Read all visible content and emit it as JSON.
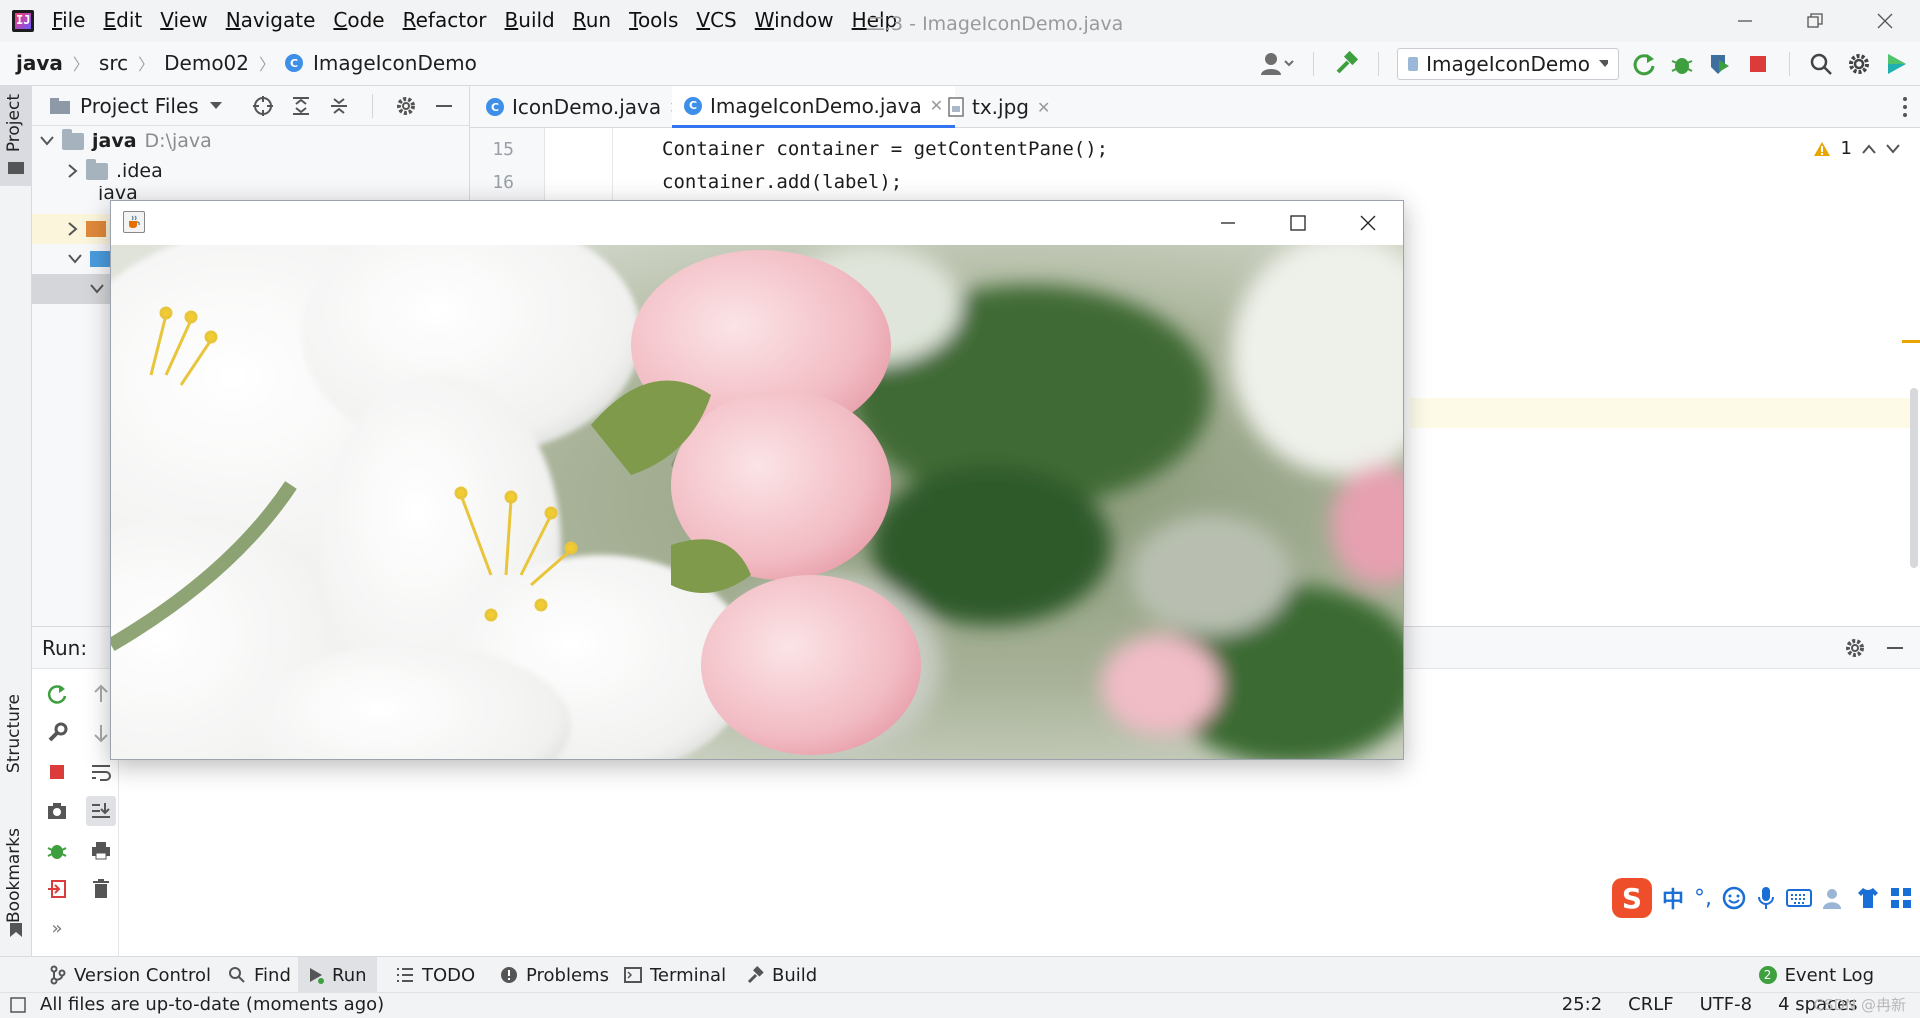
{
  "menubar": {
    "items": [
      "File",
      "Edit",
      "View",
      "Navigate",
      "Code",
      "Refactor",
      "Build",
      "Run",
      "Tools",
      "VCS",
      "Window",
      "Help"
    ],
    "title": "二.3 - ImageIconDemo.java"
  },
  "navbar": {
    "crumbs": [
      "java",
      "src",
      "Demo02",
      "ImageIconDemo"
    ],
    "run_config": "ImageIconDemo"
  },
  "left_strip": {
    "project": "Project",
    "structure": "Structure",
    "bookmarks": "Bookmarks"
  },
  "project_panel": {
    "header": "Project Files",
    "root_name": "java",
    "root_path": "D:\\java",
    "idea": ".idea",
    "partial": "java"
  },
  "editor": {
    "tabs": [
      {
        "label": "IconDemo.java"
      },
      {
        "label": "ImageIconDemo.java"
      },
      {
        "label": "tx.jpg"
      }
    ],
    "lines": [
      {
        "num": "15",
        "code": "Container container = getContentPane();"
      },
      {
        "num": "16",
        "code": "container.add(label);"
      }
    ],
    "warnings": "1"
  },
  "run_panel": {
    "title": "Run:"
  },
  "bottom_tabs": {
    "version_control": "Version Control",
    "find": "Find",
    "run": "Run",
    "todo": "TODO",
    "problems": "Problems",
    "terminal": "Terminal",
    "build": "Build",
    "event_log": "Event Log",
    "event_count": "2"
  },
  "status": {
    "message": "All files are up-to-date (moments ago)",
    "position": "25:2",
    "line_sep": "CRLF",
    "encoding": "UTF-8",
    "indent": "4 spaces",
    "watermark": "CSDN @冉新"
  },
  "ime": {
    "logo": "S",
    "lang": "中"
  },
  "colors": {
    "accent": "#3574f0",
    "run_green": "#3e9f3e",
    "stop_red": "#db3b3b",
    "warn_yellow": "#e8a500"
  }
}
